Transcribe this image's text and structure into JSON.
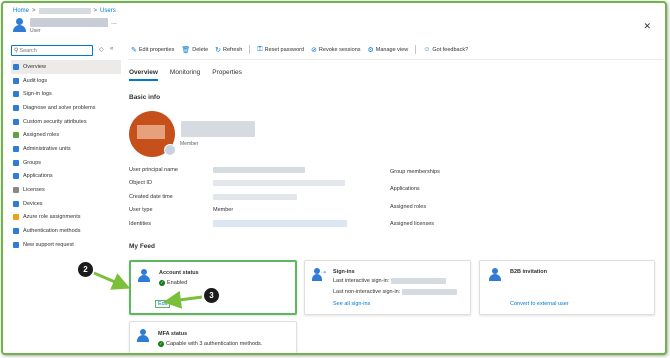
{
  "breadcrumb": {
    "home": "Home",
    "sep1": ">",
    "sep2": ">",
    "users": "Users"
  },
  "header": {
    "subtitle": "User",
    "more": "...",
    "close": "✕"
  },
  "sidebar": {
    "search_placeholder": "Search",
    "items": [
      {
        "label": "Overview",
        "color": "#2f7bd6"
      },
      {
        "label": "Audit logs",
        "color": "#2f7bd6"
      },
      {
        "label": "Sign-in logs",
        "color": "#2f7bd6"
      },
      {
        "label": "Diagnose and solve problems",
        "color": "#2f7bd6"
      },
      {
        "label": "Custom security attributes",
        "color": "#2f7bd6"
      },
      {
        "label": "Assigned roles",
        "color": "#5ea340"
      },
      {
        "label": "Administrative units",
        "color": "#2f7bd6"
      },
      {
        "label": "Groups",
        "color": "#2f7bd6"
      },
      {
        "label": "Applications",
        "color": "#2f7bd6"
      },
      {
        "label": "Licenses",
        "color": "#8a8886"
      },
      {
        "label": "Devices",
        "color": "#2f7bd6"
      },
      {
        "label": "Azure role assignments",
        "color": "#e8a317"
      },
      {
        "label": "Authentication methods",
        "color": "#2f7bd6"
      },
      {
        "label": "New support request",
        "color": "#2f7bd6"
      }
    ]
  },
  "toolbar": {
    "edit": "Edit properties",
    "delete": "Delete",
    "refresh": "Refresh",
    "reset": "Reset password",
    "revoke": "Revoke sessions",
    "manage": "Manage view",
    "feedback": "Got feedback?"
  },
  "tabs": [
    "Overview",
    "Monitoring",
    "Properties"
  ],
  "basic_info": {
    "title": "Basic info",
    "member_label": "Member",
    "left": [
      {
        "label": "User principal name"
      },
      {
        "label": "Object ID"
      },
      {
        "label": "Created date time"
      },
      {
        "label": "User type",
        "value": "Member"
      },
      {
        "label": "Identities"
      }
    ],
    "right": [
      {
        "label": "Group memberships"
      },
      {
        "label": "Applications"
      },
      {
        "label": "Assigned roles"
      },
      {
        "label": "Assigned licenses"
      }
    ]
  },
  "feed": {
    "title": "My Feed",
    "account": {
      "title": "Account status",
      "status": "Enabled",
      "edit": "Edit"
    },
    "signins": {
      "title": "Sign-ins",
      "last_interactive": "Last interactive sign-in:",
      "last_noninteractive": "Last non-interactive sign-in:",
      "link": "See all sign-ins"
    },
    "b2b": {
      "title": "B2B invitation",
      "link": "Convert to external user"
    },
    "mfa": {
      "title": "MFA status",
      "status": "Capable with 3 authentication methods."
    }
  },
  "callouts": {
    "c2": "2",
    "c3": "3"
  },
  "colors": {
    "accent": "#0078d4",
    "highlight": "#5cb85c",
    "arrow": "#7cbf3a"
  }
}
